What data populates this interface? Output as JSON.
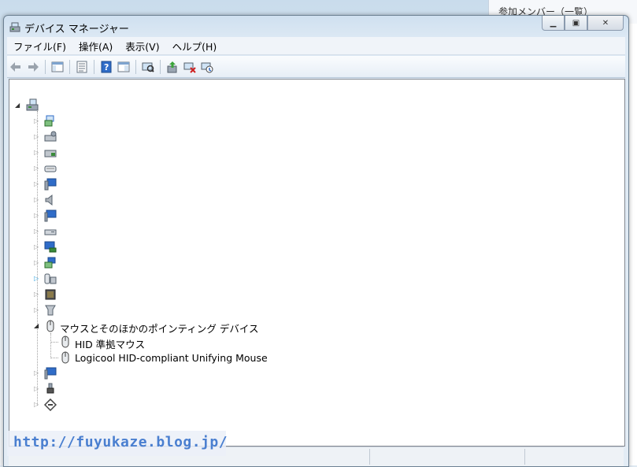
{
  "background": {
    "right_panel_title": "参加メンバー（一覧）"
  },
  "window": {
    "title": "デバイス マネージャー",
    "menu": [
      "ファイル(F)",
      "操作(A)",
      "表示(V)",
      "ヘルプ(H)"
    ],
    "toolbar": [
      "back-icon",
      "forward-icon",
      "sep",
      "show-hide-tree-icon",
      "sep",
      "properties-icon",
      "sep",
      "help-icon",
      "action-pane-icon",
      "sep",
      "scan-hardware-icon",
      "sep",
      "update-driver-icon",
      "uninstall-icon",
      "disable-icon"
    ],
    "tree": {
      "categories": [
        {
          "icon": "network-adapter-icon",
          "expanded": false,
          "label": ""
        },
        {
          "icon": "disk-drive-icon",
          "expanded": false,
          "label": ""
        },
        {
          "icon": "storage-controller-icon",
          "expanded": false,
          "label": ""
        },
        {
          "icon": "keyboard-icon",
          "expanded": false,
          "label": ""
        },
        {
          "icon": "computer-icon",
          "expanded": false,
          "label": ""
        },
        {
          "icon": "sound-icon",
          "expanded": false,
          "label": ""
        },
        {
          "icon": "monitor-icon",
          "expanded": false,
          "label": ""
        },
        {
          "icon": "dvd-drive-icon",
          "expanded": false,
          "label": ""
        },
        {
          "icon": "display-adapter-icon",
          "expanded": false,
          "label": ""
        },
        {
          "icon": "network-icon",
          "expanded": false,
          "label": ""
        },
        {
          "icon": "hid-icon",
          "expanded": false,
          "label": "",
          "selected_expander": true
        },
        {
          "icon": "processor-icon",
          "expanded": false,
          "label": ""
        },
        {
          "icon": "ide-controller-icon",
          "expanded": false,
          "label": ""
        },
        {
          "icon": "mouse-icon",
          "expanded": true,
          "label": "マウスとそのほかのポインティング デバイス",
          "children": [
            "HID 準拠マウス",
            "Logicool HID-compliant Unifying Mouse"
          ]
        },
        {
          "icon": "monitor-icon",
          "expanded": false,
          "label": ""
        },
        {
          "icon": "usb-icon",
          "expanded": false,
          "label": ""
        },
        {
          "icon": "system-device-icon",
          "expanded": false,
          "label": ""
        }
      ]
    }
  },
  "watermark": "http://fuyukaze.blog.jp/"
}
